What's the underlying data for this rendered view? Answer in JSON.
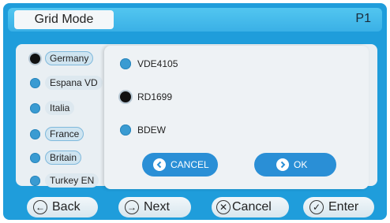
{
  "header": {
    "title": "Grid Mode",
    "page": "P1"
  },
  "grid_list": {
    "items": [
      {
        "label": "Germany",
        "selected": true
      },
      {
        "label": "Espana VD",
        "selected": false
      },
      {
        "label": "Italia",
        "selected": false
      },
      {
        "label": "France",
        "selected": false
      },
      {
        "label": "Britain",
        "selected": false
      },
      {
        "label": "Turkey EN",
        "selected": false
      }
    ]
  },
  "popup": {
    "options": [
      {
        "label": "VDE4105",
        "selected": false
      },
      {
        "label": "RD1699",
        "selected": true
      },
      {
        "label": "BDEW",
        "selected": false
      }
    ],
    "cancel_label": "CANCEL",
    "ok_label": "OK"
  },
  "footer": {
    "back_label": "Back",
    "next_label": "Next",
    "cancel_label": "Cancel",
    "enter_label": "Enter"
  },
  "icons": [
    "back-arrow-icon",
    "next-arrow-icon",
    "cancel-x-icon",
    "enter-check-icon",
    "back-chevron-icon",
    "check-icon"
  ],
  "colors": {
    "screen_bg": "#1f9ddb",
    "header_bg": "#3ab0e6",
    "accent_button": "#2a8fd6"
  }
}
